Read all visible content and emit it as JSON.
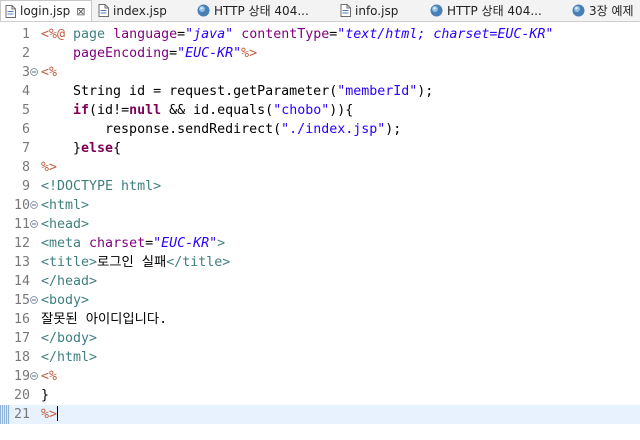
{
  "tabs": [
    {
      "label": "login.jsp",
      "icon": "jsp-file-icon",
      "active": true,
      "closable": true
    },
    {
      "label": "index.jsp",
      "icon": "jsp-file-icon",
      "active": false
    },
    {
      "label": "HTTP 상태 404...",
      "icon": "globe-icon",
      "active": false
    },
    {
      "label": "info.jsp",
      "icon": "jsp-file-icon",
      "active": false
    },
    {
      "label": "HTTP 상태 404...",
      "icon": "globe-icon",
      "active": false
    },
    {
      "label": "3장 예제",
      "icon": "globe-icon",
      "active": false
    }
  ],
  "close_symbol": "⊠",
  "editor": {
    "line_numbers": [
      "1",
      "2",
      "3",
      "4",
      "5",
      "6",
      "7",
      "8",
      "9",
      "10",
      "11",
      "12",
      "13",
      "14",
      "15",
      "16",
      "17",
      "18",
      "19",
      "20",
      "21"
    ],
    "current_line": 21,
    "lines": [
      [
        [
          "jspd",
          "<%@ "
        ],
        [
          "akey",
          "page "
        ],
        [
          "aname",
          "language"
        ],
        [
          "pl",
          "="
        ],
        [
          "aval",
          "\"java\""
        ],
        [
          "pl",
          " "
        ],
        [
          "aname",
          "contentType"
        ],
        [
          "pl",
          "="
        ],
        [
          "aval",
          "\"text/html; charset=EUC-KR\""
        ]
      ],
      [
        [
          "pl",
          "    "
        ],
        [
          "aname",
          "pageEncoding"
        ],
        [
          "pl",
          "="
        ],
        [
          "aval",
          "\"EUC-KR\""
        ],
        [
          "jspd",
          "%>"
        ]
      ],
      [
        [
          "jspd",
          "<%"
        ]
      ],
      [
        [
          "pl",
          "    String id = request.getParameter("
        ],
        [
          "str",
          "\"memberId\""
        ],
        [
          "pl",
          ");"
        ]
      ],
      [
        [
          "pl",
          "    "
        ],
        [
          "kw",
          "if"
        ],
        [
          "pl",
          "(id!="
        ],
        [
          "kw",
          "null"
        ],
        [
          "pl",
          " && id.equals("
        ],
        [
          "str",
          "\"chobo\""
        ],
        [
          "pl",
          "))"
        ],
        [
          "pl",
          "{"
        ]
      ],
      [
        [
          "pl",
          "        response.sendRedirect("
        ],
        [
          "str",
          "\"./index.jsp\""
        ],
        [
          "pl",
          ");"
        ]
      ],
      [
        [
          "pl",
          "    }"
        ],
        [
          "kw",
          "else"
        ],
        [
          "pl",
          "{"
        ]
      ],
      [
        [
          "jspd",
          "%>"
        ]
      ],
      [
        [
          "tag",
          "<!DOCTYPE html>"
        ]
      ],
      [
        [
          "tag",
          "<html>"
        ]
      ],
      [
        [
          "tag",
          "<head>"
        ]
      ],
      [
        [
          "tag",
          "<meta "
        ],
        [
          "aname",
          "charset"
        ],
        [
          "pl",
          "="
        ],
        [
          "aval",
          "\"EUC-KR\""
        ],
        [
          "tag",
          ">"
        ]
      ],
      [
        [
          "tag",
          "<title>"
        ],
        [
          "txt",
          "로그인 실패"
        ],
        [
          "tag",
          "</title>"
        ]
      ],
      [
        [
          "tag",
          "</head>"
        ]
      ],
      [
        [
          "tag",
          "<body>"
        ]
      ],
      [
        [
          "txt",
          "잘못된 아이디입니다."
        ]
      ],
      [
        [
          "tag",
          "</body>"
        ]
      ],
      [
        [
          "tag",
          "</html>"
        ]
      ],
      [
        [
          "jspd",
          "<%"
        ]
      ],
      [
        [
          "pl",
          "}"
        ]
      ],
      [
        [
          "jspd",
          "%>"
        ]
      ]
    ],
    "foldable_lines": [
      3,
      10,
      11,
      15,
      19
    ]
  },
  "colors": {
    "jsp_delimiter": "#bf5f3f",
    "tag": "#3f7f7f",
    "attribute_name": "#7f007f",
    "string": "#2a00ff",
    "keyword": "#7f0055",
    "current_line_bg": "#e8f2fe"
  }
}
